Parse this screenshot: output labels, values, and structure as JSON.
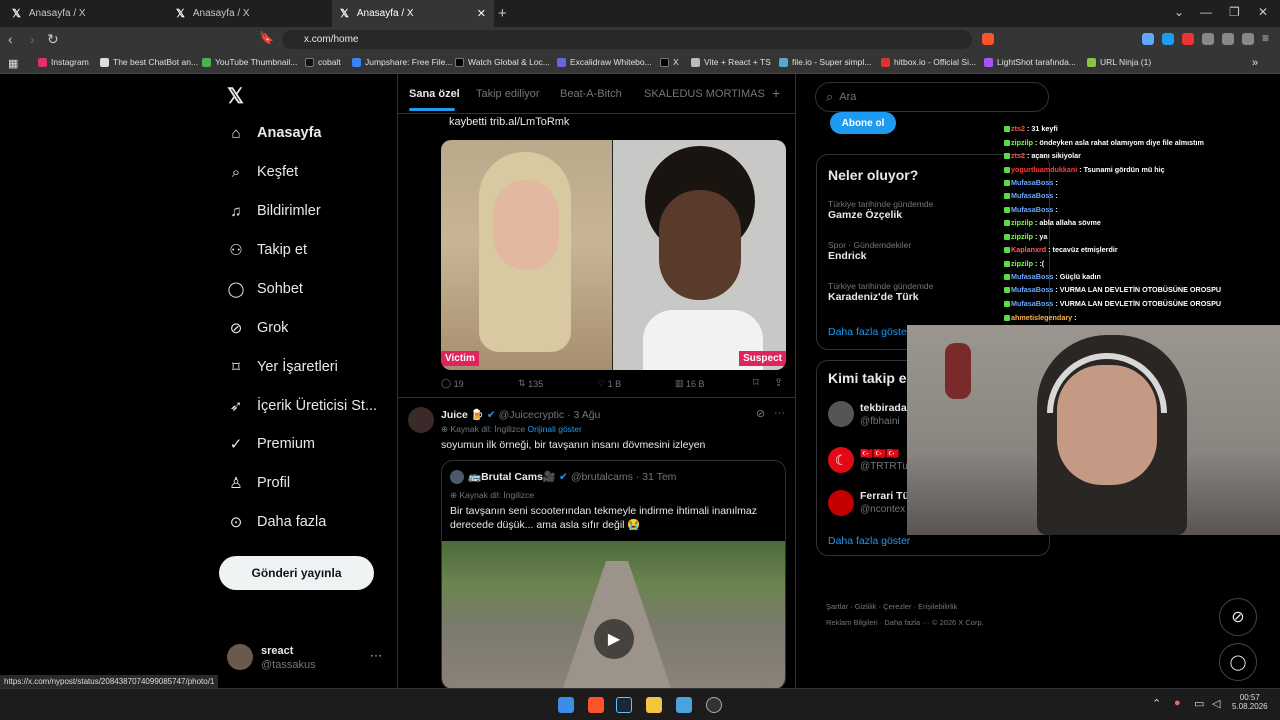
{
  "browser": {
    "tabs": [
      {
        "title": "Anasayfa / X"
      },
      {
        "title": "Anasayfa / X"
      },
      {
        "title": "Anasayfa / X"
      }
    ],
    "url": "x.com/home",
    "bookmarks": [
      "Instagram",
      "The best ChatBot an...",
      "YouTube Thumbnail...",
      "cobalt",
      "Jumpshare: Free File...",
      "Watch Global & Loc...",
      "Excalidraw Whitebo...",
      "X",
      "Vite + React + TS",
      "file.io - Super simpl...",
      "hitbox.io - Official Si...",
      "LightShot tarafında...",
      "URL Ninja (1)"
    ],
    "status_url": "https://x.com/nypost/status/2084387074099085747/photo/1"
  },
  "nav": {
    "items": [
      {
        "label": "Anasayfa"
      },
      {
        "label": "Keşfet"
      },
      {
        "label": "Bildirimler"
      },
      {
        "label": "Takip et"
      },
      {
        "label": "Sohbet"
      },
      {
        "label": "Grok"
      },
      {
        "label": "Yer İşaretleri"
      },
      {
        "label": "İçerik Üreticisi St..."
      },
      {
        "label": "Premium"
      },
      {
        "label": "Profil"
      },
      {
        "label": "Daha fazla"
      }
    ],
    "post_button": "Gönderi yayınla",
    "account": {
      "name": "sreact",
      "handle": "@tassakus"
    }
  },
  "feed": {
    "tabs": [
      "Sana özel",
      "Takip ediliyor",
      "Beat-A-Bitch",
      "SKALEDUS MORTIMAS"
    ],
    "post1": {
      "text": "kaybetti trib.al/LmToRmk",
      "label_left": "Victim",
      "label_right": "Suspect",
      "replies": "19",
      "reposts": "135",
      "likes": "1 B",
      "views": "16 B"
    },
    "post2": {
      "name": "Juice 🍺",
      "handle": "@Juicecryptic",
      "date": "3 Ağu",
      "lang": "Kaynak dil: İngilizce",
      "show_original": "Orijinali göster",
      "text": "soyumun ilk örneği, bir tavşanın insanı dövmesini izleyen",
      "quote": {
        "name": "🚌Brutal Cams🎥",
        "handle": "@brutalcams",
        "date": "31 Tem",
        "lang": "Kaynak dil: İngilizce",
        "text": "Bir tavşanın seni scooterından tekmeyle indirme ihtimali inanılmaz derecede düşük... ama asla sıfır değil 😭"
      }
    }
  },
  "right": {
    "search_placeholder": "Ara",
    "subscribe_button": "Abone ol",
    "trends_title": "Neler oluyor?",
    "trends": [
      {
        "category": "Türkiye tarihinde gündemde",
        "name": "Gamze Özçelik"
      },
      {
        "category": "Spor · Gündemdekiler",
        "name": "Endrick"
      },
      {
        "category": "Türkiye tarihinde gündemde",
        "name": "Karadeniz'de Türk"
      }
    ],
    "show_more": "Daha fazla göster",
    "follow_title": "Kimi takip e",
    "follow": [
      {
        "name": "tekbirada",
        "handle": "@fbhaini"
      },
      {
        "name": "🇹🇷🇹🇷🇹🇷",
        "handle": "@TRTRTur"
      },
      {
        "name": "Ferrari Tü",
        "handle": "@ncontex"
      }
    ],
    "show_more2": "Daha fazla göster",
    "footer": [
      "Şartlar",
      "Gizlilik",
      "Çerezler",
      "Erişilebilirlik",
      "Reklam Bilgileri",
      "Daha fazla ···",
      "© 2026 X Corp."
    ]
  },
  "chat": [
    {
      "user": "zts2",
      "color": "#ff4d4d",
      "msg": ": 31 keyfi"
    },
    {
      "user": "zipzilp",
      "color": "#7cff4d",
      "msg": ": öndeyken asla rahat olamıyom diye file almıstım"
    },
    {
      "user": "zts2",
      "color": "#ff4d4d",
      "msg": ": açanı sikiyolar"
    },
    {
      "user": "yogurtluamdukkani",
      "color": "#ff3b3b",
      "msg": ": Tsunami gördün mü hiç"
    },
    {
      "user": "MufasaBoss",
      "color": "#6aa8ff",
      "msg": ":"
    },
    {
      "user": "MufasaBoss",
      "color": "#6aa8ff",
      "msg": ":"
    },
    {
      "user": "MufasaBoss",
      "color": "#6aa8ff",
      "msg": ":"
    },
    {
      "user": "zipzilp",
      "color": "#7cff4d",
      "msg": ": abla allaha sövme"
    },
    {
      "user": "zipzilp",
      "color": "#7cff4d",
      "msg": ": ya"
    },
    {
      "user": "Kaplanxrd",
      "color": "#ff5c5c",
      "msg": ": tecavüz etmişlerdir"
    },
    {
      "user": "zipzilp",
      "color": "#7cff4d",
      "msg": ": :("
    },
    {
      "user": "MufasaBoss",
      "color": "#6aa8ff",
      "msg": ": Güçlü kadın"
    },
    {
      "user": "MufasaBoss",
      "color": "#6aa8ff",
      "msg": ": VURMA LAN DEVLETİN OTOBÜSÜNE OROSPU"
    },
    {
      "user": "MufasaBoss",
      "color": "#6aa8ff",
      "msg": ": VURMA LAN DEVLETİN OTOBÜSÜNE OROSPU"
    },
    {
      "user": "ahmetislegendary",
      "color": "#ffb347",
      "msg": ":"
    }
  ],
  "taskbar": {
    "time": "00:57",
    "date": "5.08.2026"
  }
}
